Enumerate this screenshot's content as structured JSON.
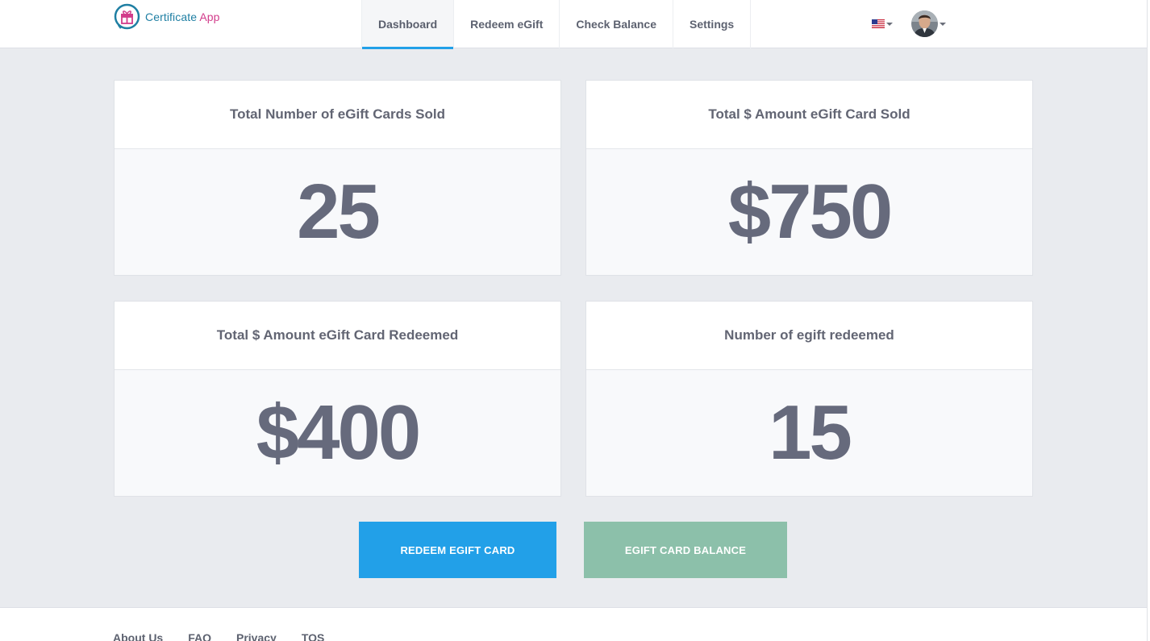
{
  "brand": {
    "name": "Certificate",
    "suffix": "App"
  },
  "nav": {
    "items": [
      {
        "label": "Dashboard",
        "active": true
      },
      {
        "label": "Redeem eGift",
        "active": false
      },
      {
        "label": "Check Balance",
        "active": false
      },
      {
        "label": "Settings",
        "active": false
      }
    ]
  },
  "header_icons": {
    "language": "us-flag-icon",
    "user": "avatar"
  },
  "cards": [
    {
      "title": "Total Number of eGift Cards Sold",
      "value": "25"
    },
    {
      "title": "Total $ Amount eGift Card Sold",
      "value": "$750"
    },
    {
      "title": "Total $ Amount eGift Card Redeemed",
      "value": "$400"
    },
    {
      "title": "Number of egift redeemed",
      "value": "15"
    }
  ],
  "buttons": {
    "redeem": "REDEEM EGIFT CARD",
    "balance": "EGIFT CARD BALANCE"
  },
  "footer": {
    "links": [
      "About Us",
      "FAQ",
      "Privacy",
      "TOS"
    ]
  },
  "colors": {
    "accent": "#22a0e8",
    "balance_button": "#8cc0aa",
    "brand_primary": "#1f7fa3",
    "brand_secondary": "#d23c8b",
    "value_text": "#666a7c"
  }
}
